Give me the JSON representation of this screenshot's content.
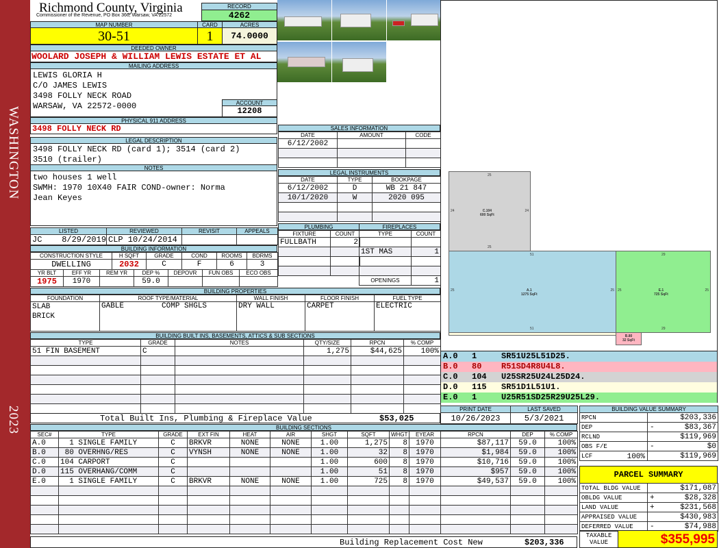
{
  "sidebar": {
    "district": "WASHINGTON",
    "year": "2023"
  },
  "header": {
    "county": "Richmond County, Virginia",
    "subtitle": "Commissioner of the Revenue, PO Box 366, Warsaw, VA 22572"
  },
  "record": {
    "label": "RECORD",
    "value": "4262"
  },
  "map": {
    "label": "MAP NUMBER",
    "value": "30-51"
  },
  "card": {
    "label": "CARD",
    "value": "1"
  },
  "acres": {
    "label": "ACRES",
    "value": "74.0000"
  },
  "owner": {
    "label": "DEEDED OWNER",
    "value": "WOOLARD JOSEPH & WILLIAM LEWIS ESTATE ET AL"
  },
  "mailing": {
    "label": "MAILING ADDRESS",
    "lines": [
      "LEWIS GLORIA H",
      "C/O JAMES LEWIS",
      "3498 FOLLY NECK ROAD",
      "WARSAW, VA 22572-0000"
    ]
  },
  "account": {
    "label": "ACCOUNT",
    "value": "12208"
  },
  "physical": {
    "label": "PHYSICAL 911 ADDRESS",
    "value": "3498 FOLLY NECK RD"
  },
  "legal": {
    "label": "LEGAL DESCRIPTION",
    "lines": [
      "3498 FOLLY NECK RD (card 1); 3514 (card 2)",
      "3510 (trailer)"
    ]
  },
  "notes": {
    "label": "NOTES",
    "lines": [
      "two houses 1 well",
      "SWMH: 1970 10X40 FAIR COND-owner: Norma",
      "Jean Keyes"
    ]
  },
  "review": {
    "headers": [
      "LISTED",
      "REVIEWED",
      "REVISIT",
      "APPEALS"
    ],
    "values": [
      "JC    8/29/2019",
      "CLP 10/24/2014",
      "",
      ""
    ]
  },
  "building_info": {
    "title": "BUILDING INFORMATION",
    "h1": [
      "CONSTRUCTION STYLE",
      "H SQFT",
      "GRADE",
      "COND",
      "ROOMS",
      "BDRMS"
    ],
    "v1": [
      "DWELLING",
      "2032",
      "C",
      "F",
      "6",
      "3"
    ],
    "h2": [
      "YR BLT",
      "EFF YR",
      "REM YR",
      "DEP %",
      "DEPOVR",
      "FUN OBS",
      "ECO OBS"
    ],
    "v2": [
      "1975",
      "1970",
      "",
      "59.0",
      "",
      "",
      ""
    ]
  },
  "sales": {
    "title": "SALES INFORMATION",
    "headers": [
      "DATE",
      "AMOUNT",
      "CODE"
    ],
    "rows": [
      [
        "6/12/2002",
        "",
        ""
      ],
      [
        "",
        "",
        ""
      ],
      [
        "",
        "",
        ""
      ]
    ]
  },
  "instruments": {
    "title": "LEGAL INSTRUMENTS",
    "headers": [
      "DATE",
      "TYPE",
      "BOOKPAGE"
    ],
    "rows": [
      [
        "6/12/2002",
        "D",
        "WB 21 847"
      ],
      [
        "10/1/2020",
        "W",
        "2020 095"
      ],
      [
        "",
        "",
        ""
      ],
      [
        "",
        "",
        ""
      ]
    ]
  },
  "plumbing": {
    "title": "PLUMBING",
    "headers": [
      "FIXTURE",
      "COUNT"
    ],
    "rows": [
      [
        "FULLBATH",
        "2"
      ],
      [
        "",
        ""
      ],
      [
        "",
        ""
      ],
      [
        "",
        ""
      ]
    ]
  },
  "fireplaces": {
    "title": "FIREPLACES",
    "headers": [
      "TYPE",
      "COUNT"
    ],
    "rows": [
      [
        "",
        ""
      ],
      [
        "1ST MAS",
        "1"
      ],
      [
        "",
        ""
      ],
      [
        "",
        ""
      ]
    ],
    "openings_label": "OPENINGS",
    "openings": "1"
  },
  "properties": {
    "title": "BUILDING PROPERTIES",
    "headers": [
      "FOUNDATION",
      "ROOF TYPE/MATERIAL",
      "WALL FINISH",
      "FLOOR FINISH",
      "FUEL TYPE"
    ],
    "foundation": [
      "SLAB",
      "BRICK"
    ],
    "roof_type": "GABLE",
    "roof_material": "COMP SHGLS",
    "wall": "DRY WALL",
    "floor": "CARPET",
    "fuel": "ELECTRIC"
  },
  "builtins": {
    "title": "BUILDING BUILT INS, BASEMENTS, ATTICS & SUB SECTIONS",
    "headers": [
      "TYPE",
      "GRADE",
      "NOTES",
      "QTY/SIZE",
      "RPCN",
      "% COMP"
    ],
    "rows": [
      [
        "51 FIN BASEMENT",
        "C",
        "",
        "1,275",
        "$44,625",
        "100%"
      ]
    ],
    "total_label": "Total Built Ins, Plumbing & Fireplace Value",
    "total": "$53,025"
  },
  "sections": {
    "title": "BUILDING SECTIONS",
    "headers": [
      "SEC#",
      "TYPE",
      "GRADE",
      "EXT FIN",
      "HEAT",
      "AIR",
      "SHGT",
      "SQFT",
      "WHGT",
      "EYEAR",
      "RPCN",
      "DEP",
      "% COMP"
    ],
    "rows": [
      [
        "A.0",
        "  1 SINGLE FAMILY",
        "C",
        "BRKVR",
        "NONE",
        "NONE",
        "1.00",
        "1,275",
        "8",
        "1970",
        "$87,117",
        "59.0",
        "100%"
      ],
      [
        "B.0",
        " 80 OVERHNG/RES",
        "C",
        "VYNSH",
        "NONE",
        "NONE",
        "1.00",
        "32",
        "8",
        "1970",
        "$1,984",
        "59.0",
        "100%"
      ],
      [
        "C.0",
        "104 CARPORT",
        "C",
        "",
        "",
        "",
        "1.00",
        "600",
        "8",
        "1970",
        "$10,716",
        "59.0",
        "100%"
      ],
      [
        "D.0",
        "115 OVERHANG/COMM",
        "C",
        "",
        "",
        "",
        "1.00",
        "51",
        "8",
        "1970",
        "$957",
        "59.0",
        "100%"
      ],
      [
        "E.0",
        "  1 SINGLE FAMILY",
        "C",
        "BRKVR",
        "NONE",
        "NONE",
        "1.00",
        "725",
        "8",
        "1970",
        "$49,537",
        "59.0",
        "100%"
      ]
    ],
    "total_label": "Building Replacement Cost New",
    "total": "$203,336"
  },
  "dates": {
    "print_label": "PRINT DATE",
    "print": "10/26/2023",
    "saved_label": "LAST SAVED",
    "saved": "5/3/2021"
  },
  "value_summary": {
    "title": "BUILDING VALUE SUMMARY",
    "rows": [
      {
        "label": "RPCN",
        "sign": "",
        "value": "$203,336"
      },
      {
        "label": "DEP",
        "sign": "-",
        "value": "$83,367"
      },
      {
        "label": "RCLND",
        "sign": "",
        "value": "$119,969"
      },
      {
        "label": "OBS F/E",
        "sign": "-",
        "value": "$0"
      },
      {
        "label": "LCF",
        "sign": "",
        "value": "$119,969"
      }
    ],
    "lcf_pct": "100%"
  },
  "parcel": {
    "title": "PARCEL SUMMARY",
    "rows": [
      {
        "label": "TOTAL BLDG VALUE",
        "sign": "",
        "value": "$171,087"
      },
      {
        "label": "OBLDG VALUE",
        "sign": "+",
        "value": "$28,328"
      },
      {
        "label": "LAND VALUE",
        "sign": "+",
        "value": "$231,568"
      },
      {
        "label": "APPRAISED VALUE",
        "sign": "",
        "value": "$430,983"
      },
      {
        "label": "DEFERRED VALUE",
        "sign": "-",
        "value": "$74,988"
      }
    ],
    "taxable_label": "TAXABLE VALUE",
    "taxable": "$355,995"
  },
  "sketch": {
    "shapes": [
      {
        "id": "C",
        "label": "C.104",
        "area": "600 SqFt",
        "dims": [
          "25",
          "24",
          "24",
          "25"
        ]
      },
      {
        "id": "A",
        "label": "A.1",
        "area": "1275 SqFt",
        "dims": [
          "51",
          "25",
          "25",
          "51"
        ]
      },
      {
        "id": "E",
        "label": "E.1",
        "area": "725 SqFt",
        "dims": [
          "29",
          "25",
          "25",
          "29"
        ]
      },
      {
        "id": "B",
        "label": "B.80",
        "area": "32 SqFt"
      }
    ],
    "legend": [
      {
        "sec": "A.0",
        "code": "1",
        "vector": "SR51U25L51D25.",
        "color": "#add8e6"
      },
      {
        "sec": "B.0",
        "code": "80",
        "vector": "R51SD4R8U4L8.",
        "color": "#ffb6c1"
      },
      {
        "sec": "C.0",
        "code": "104",
        "vector": "U25SR25U24L25D24.",
        "color": "#d3d3d3"
      },
      {
        "sec": "D.0",
        "code": "115",
        "vector": "SR51D1L51U1.",
        "color": "#fffde0"
      },
      {
        "sec": "E.0",
        "code": "1",
        "vector": "U25R51SD25R29U25L29.",
        "color": "#90ee90"
      }
    ]
  },
  "colors": {
    "sidebar": "#a3282b",
    "header": "#add8e6",
    "highlight": "#ffff00",
    "record": "#90ee90",
    "alert": "#cc0000"
  }
}
